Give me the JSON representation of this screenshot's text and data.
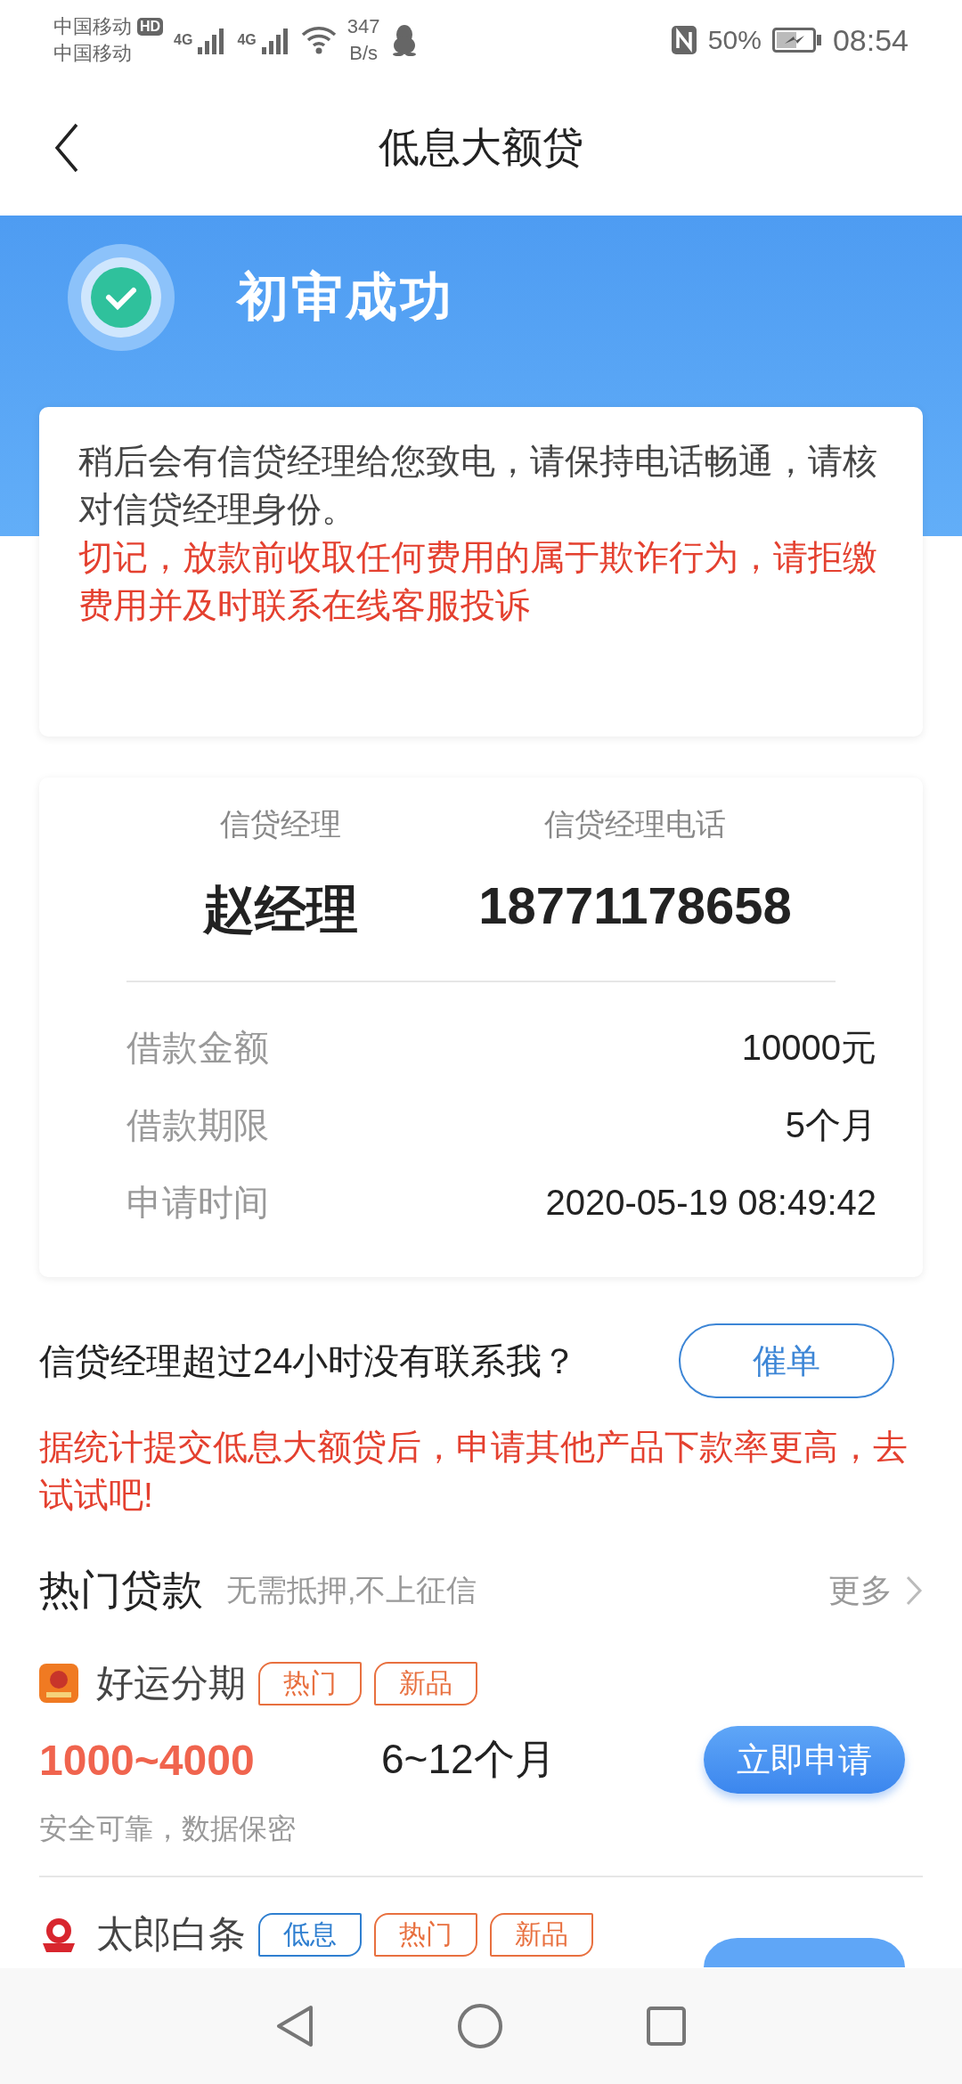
{
  "status_bar": {
    "carrier_1": "中国移动",
    "hd_badge": "HD",
    "carrier_2": "中国移动",
    "network_1": "4G",
    "network_2": "4G",
    "speed_value": "347",
    "speed_unit": "B/s",
    "battery_percent": "50%",
    "time": "08:54"
  },
  "header": {
    "title": "低息大额贷"
  },
  "banner": {
    "title": "初审成功"
  },
  "notice": {
    "text": "稍后会有信贷经理给您致电，请保持电话畅通，请核对信贷经理身份。",
    "warning": "切记，放款前收取任何费用的属于欺诈行为，请拒缴费用并及时联系在线客服投诉"
  },
  "manager": {
    "name_label": "信贷经理",
    "phone_label": "信贷经理电话",
    "name": "赵经理",
    "phone": "18771178658"
  },
  "details": [
    {
      "label": "借款金额",
      "value": "10000元"
    },
    {
      "label": "借款期限",
      "value": "5个月"
    },
    {
      "label": "申请时间",
      "value": "2020-05-19 08:49:42"
    }
  ],
  "urge": {
    "question": "信贷经理超过24小时没有联系我？",
    "button": "催单"
  },
  "promo": "据统计提交低息大额贷后，申请其他产品下款率更高，去试试吧!",
  "hot_loans": {
    "title": "热门贷款",
    "subtitle": "无需抵押,不上征信",
    "more": "更多"
  },
  "products": [
    {
      "name": "好运分期",
      "tags": [
        {
          "label": "热门",
          "color": "#e8703f"
        },
        {
          "label": "新品",
          "color": "#e8703f"
        }
      ],
      "amount": "1000~4000",
      "term": "6~12个月",
      "note": "安全可靠，数据保密",
      "button": "立即申请"
    },
    {
      "name": "太郎白条",
      "tags": [
        {
          "label": "低息",
          "color": "#2f7fd0"
        },
        {
          "label": "热门",
          "color": "#e8703f"
        },
        {
          "label": "新品",
          "color": "#e8703f"
        }
      ]
    }
  ]
}
